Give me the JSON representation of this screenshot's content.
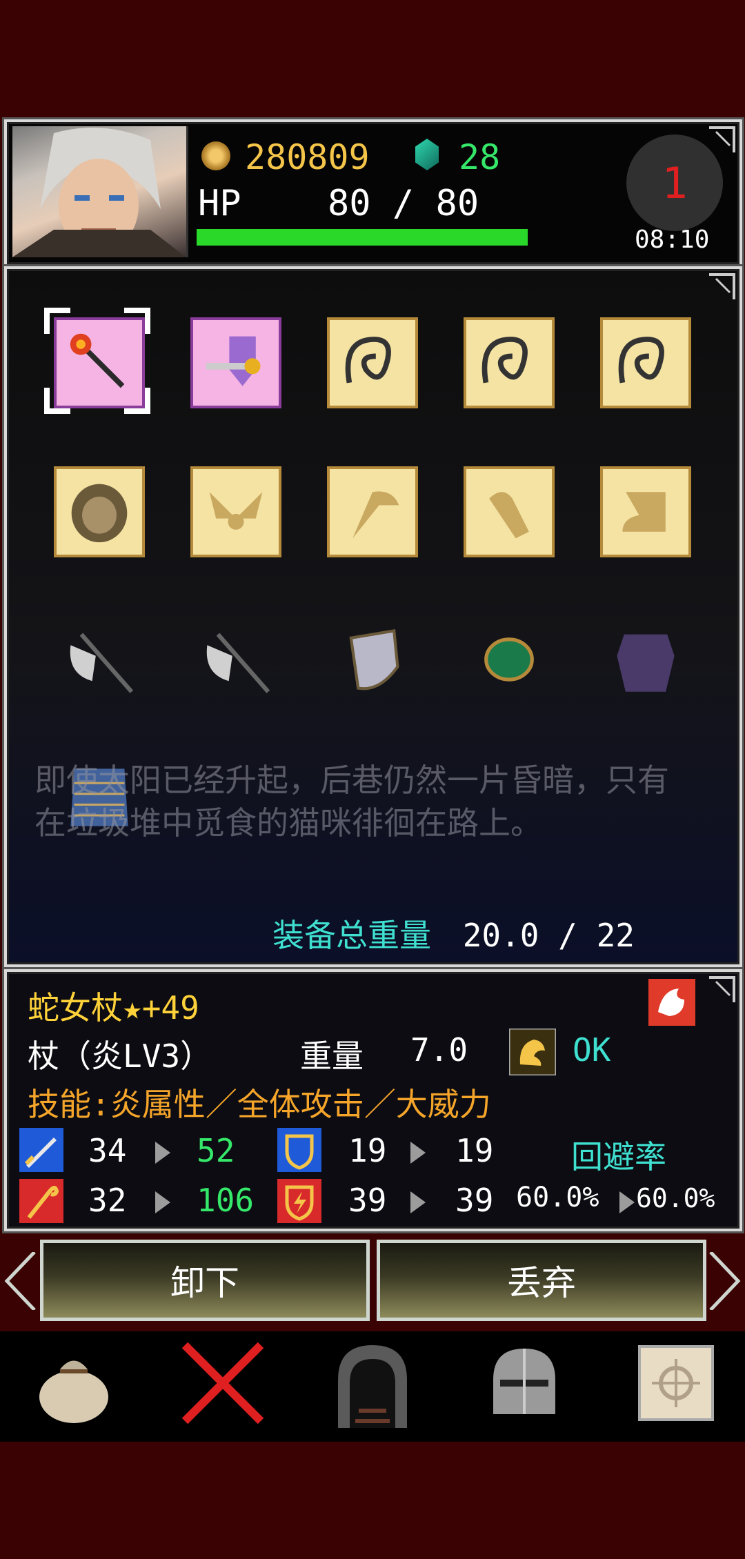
{
  "header": {
    "gold": "280809",
    "gems": "28",
    "hp_label": "HP",
    "hp_value": "80 / 80",
    "hp_fraction": 1.0,
    "turn": "1",
    "time": "08:10"
  },
  "inventory": {
    "flavor_text": "即使太阳已经升起，后巷仍然一片昏暗，只有在垃圾堆中觅食的猫咪徘徊在路上。",
    "weight_label": "装备总重量",
    "weight_value": "20.0 / 22",
    "rows": [
      [
        "staff",
        "sword",
        "whip",
        "whip",
        "whip"
      ],
      [
        "lion-helm",
        "wings",
        "pickaxe",
        "gauntlet",
        "boots"
      ],
      [
        "axe",
        "axe",
        "shield",
        "bracer",
        "armor"
      ],
      [
        "chainmail"
      ]
    ]
  },
  "item": {
    "name": "蛇女杖★+49",
    "type": "杖（炎LV3）",
    "weight_label": "重量",
    "weight": "7.0",
    "status": "OK",
    "skill": "技能:炎属性／全体攻击／大威力",
    "atk_from": "34",
    "atk_to": "52",
    "matk_from": "32",
    "matk_to": "106",
    "def_from": "19",
    "def_to": "19",
    "mdef_from": "39",
    "mdef_to": "39",
    "evade_label": "回避率",
    "evade_from": "60.0%",
    "evade_to": "60.0%"
  },
  "buttons": {
    "unequip": "卸下",
    "discard": "丢弃"
  },
  "nav": [
    "bag",
    "cancel",
    "dungeon",
    "equipment",
    "map"
  ],
  "colors": {
    "bg": "#3a0202",
    "hp": "#2ad82a",
    "accent": "#3fe0d0",
    "gold": "#f5c54a"
  }
}
